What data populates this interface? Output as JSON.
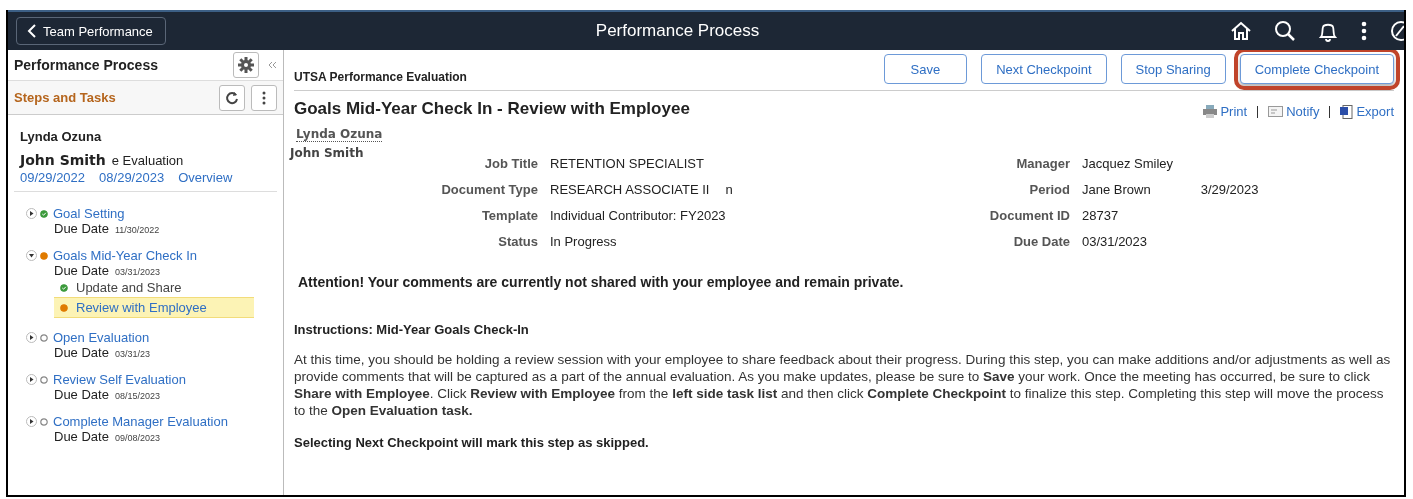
{
  "top_bar": {
    "back_button": "Team Performance",
    "title": "Performance Process"
  },
  "sidebar": {
    "title": "Performance Process",
    "section": "Steps and Tasks",
    "employee": "Lynda Ozuna",
    "overlay_name": "John Smith",
    "doc_fragment": "e Evaluation",
    "dates": [
      "09/29/2022",
      "08/29/2023"
    ],
    "overview_link": "Overview",
    "steps": [
      {
        "title": "Goal Setting",
        "completed": true,
        "in_progress": false,
        "expanded": false,
        "due_label": "Due Date",
        "due_date": "11/30/2022"
      },
      {
        "title": "Goals Mid-Year Check In",
        "completed": false,
        "in_progress": true,
        "expanded": true,
        "due_label": "Due Date",
        "due_date": "03/31/2023",
        "children": [
          {
            "title": "Update and Share",
            "completed": true,
            "in_progress": false,
            "selected": false
          },
          {
            "title": "Review with Employee",
            "completed": false,
            "in_progress": true,
            "selected": true
          }
        ]
      },
      {
        "title": "Open Evaluation",
        "completed": false,
        "in_progress": false,
        "expanded": false,
        "due_label": "Due Date",
        "due_date": "03/31/23"
      },
      {
        "title": "Review Self Evaluation",
        "completed": false,
        "in_progress": false,
        "expanded": false,
        "due_label": "Due Date",
        "due_date": "08/15/2023"
      },
      {
        "title": "Complete Manager Evaluation",
        "completed": false,
        "in_progress": false,
        "expanded": false,
        "due_label": "Due Date",
        "due_date": "09/08/2023"
      }
    ]
  },
  "main": {
    "form_title": "UTSA Performance Evaluation",
    "buttons": [
      {
        "label": "Save",
        "highlighted": false
      },
      {
        "label": "Next Checkpoint",
        "highlighted": false
      },
      {
        "label": "Stop Sharing",
        "highlighted": false
      },
      {
        "label": "Complete Checkpoint",
        "highlighted": true
      }
    ],
    "heading": "Goals Mid-Year Check In - Review with Employee",
    "actions": [
      {
        "label": "Print",
        "kind": "print"
      },
      {
        "label": "Notify",
        "kind": "notify"
      },
      {
        "label": "Export",
        "kind": "export"
      }
    ],
    "employee_link": "Lynda Ozuna",
    "overlay_name": "John Smith",
    "fields_left": [
      {
        "label": "Job Title",
        "value": "RETENTION SPECIALIST"
      },
      {
        "label": "Document Type",
        "value": "RESEARCH ASSOCIATE II",
        "extra": "n"
      },
      {
        "label": "Template",
        "value": "Individual Contributor: FY2023"
      },
      {
        "label": "Status",
        "value": "In Progress"
      }
    ],
    "fields_right": [
      {
        "label": "Manager",
        "value": "Jacquez Smiley"
      },
      {
        "label": "Period",
        "value": "Jane Brown",
        "extra": "3/29/2023"
      },
      {
        "label": "Document ID",
        "value": "28737"
      },
      {
        "label": "Due Date",
        "value": "03/31/2023"
      }
    ],
    "attention": "Attention! Your comments are currently not shared with your employee and remain private.",
    "instructions_title": "Instructions: Mid-Year Goals Check-In",
    "instructions": "At this time, you should be holding a review session with your employee to share feedback about their progress. During this step, you can make additions and/or adjustments as well as provide comments that will be captured as a part of the annual evaluation. As you make updates, please be sure to **Save** your work. Once the meeting has occurred, be sure to click **Share with Employee**. Click **Review with Employee** from the **left side task list** and then click **Complete Checkpoint** to finalize this step. Completing this step will move the process to the **Open Evaluation task.**",
    "note": "Selecting Next Checkpoint will mark this step as skipped."
  }
}
